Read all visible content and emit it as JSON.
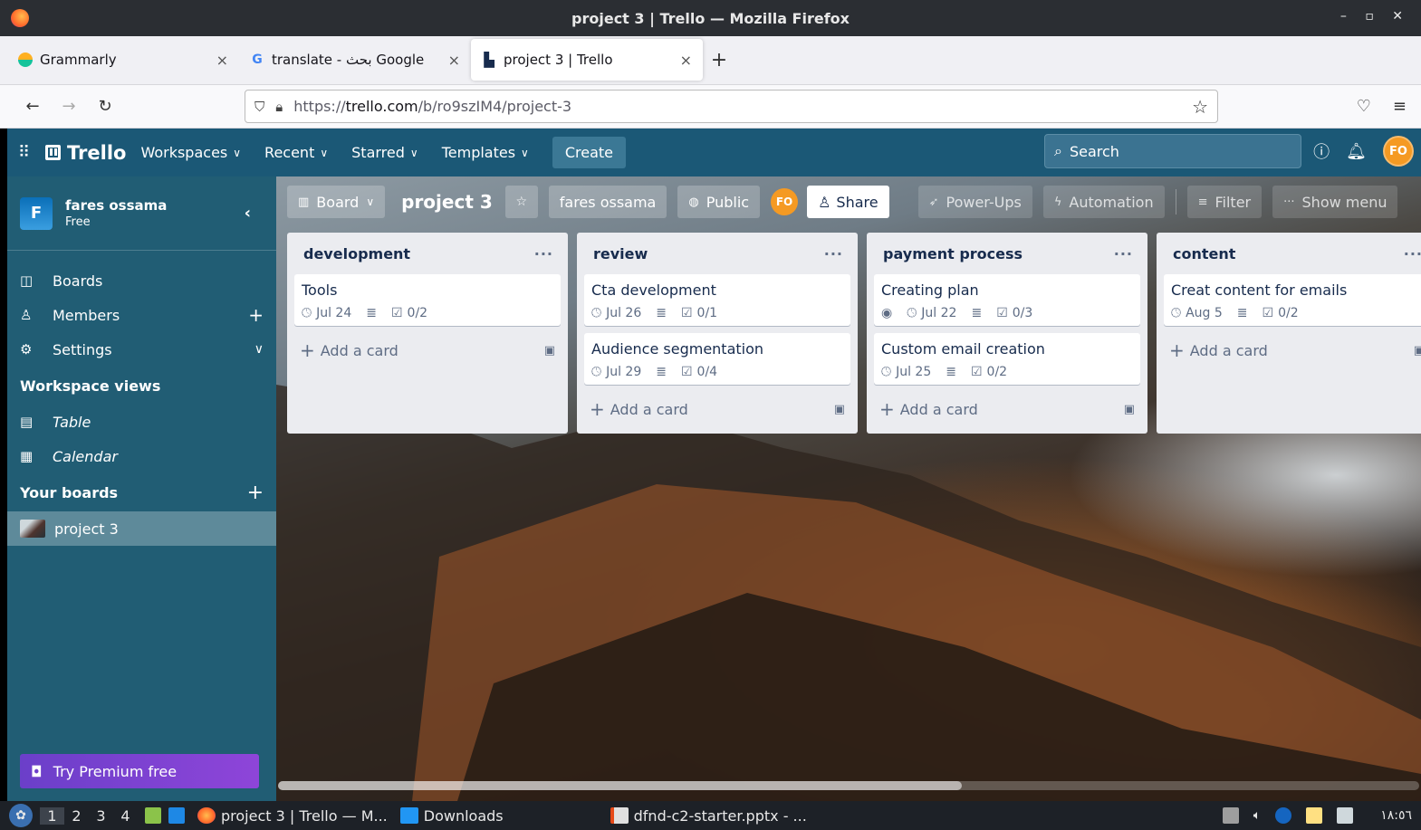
{
  "window": {
    "title": "project 3 | Trello — Mozilla Firefox",
    "controls": "– ▫ ✕"
  },
  "tabs": [
    {
      "label": "Grammarly",
      "icon": "grammarly-icon"
    },
    {
      "label": "translate - بحث Google",
      "icon": "google-icon"
    },
    {
      "label": "project 3 | Trello",
      "icon": "trello-icon",
      "active": true
    }
  ],
  "url": {
    "prefix": "https://",
    "domain": "trello.com",
    "path": "/b/ro9szIM4/project-3"
  },
  "header": {
    "menus": [
      "Workspaces",
      "Recent",
      "Starred",
      "Templates"
    ],
    "create": "Create",
    "search_placeholder": "Search",
    "avatar": "FO"
  },
  "sidebar": {
    "workspace": {
      "initial": "F",
      "name": "fares ossama",
      "plan": "Free"
    },
    "nav": [
      {
        "label": "Boards"
      },
      {
        "label": "Members"
      },
      {
        "label": "Settings"
      }
    ],
    "views_title": "Workspace views",
    "views": [
      {
        "label": "Table"
      },
      {
        "label": "Calendar"
      }
    ],
    "boards_title": "Your boards",
    "boards": [
      {
        "label": "project 3"
      }
    ],
    "premium": "Try Premium free"
  },
  "board": {
    "view": "Board",
    "title": "project 3",
    "workspace": "fares ossama",
    "visibility": "Public",
    "member": "FO",
    "share": "Share",
    "powerups": "Power-Ups",
    "automation": "Automation",
    "filter": "Filter",
    "menu": "Show menu",
    "add_card": "Add a card",
    "lists": [
      {
        "name": "development",
        "cards": [
          {
            "title": "Tools",
            "date": "Jul 24",
            "checklist": "0/2"
          }
        ]
      },
      {
        "name": "review",
        "cards": [
          {
            "title": "Cta development",
            "date": "Jul 26",
            "checklist": "0/1"
          },
          {
            "title": "Audience segmentation",
            "date": "Jul 29",
            "checklist": "0/4"
          }
        ]
      },
      {
        "name": "payment process",
        "cards": [
          {
            "title": "Creating plan",
            "date": "Jul 22",
            "checklist": "0/3",
            "watch": true
          },
          {
            "title": "Custom email creation",
            "date": "Jul 25",
            "checklist": "0/2"
          }
        ]
      },
      {
        "name": "content",
        "cards": [
          {
            "title": "Creat content for emails",
            "date": "Aug 5",
            "checklist": "0/2"
          }
        ]
      }
    ]
  },
  "taskbar": {
    "workspaces": [
      "1",
      "2",
      "3",
      "4"
    ],
    "tasks": [
      "project 3 | Trello — M...",
      "Downloads",
      "dfnd-c2-starter.pptx - ..."
    ],
    "clock": "١٨:٥٦"
  }
}
